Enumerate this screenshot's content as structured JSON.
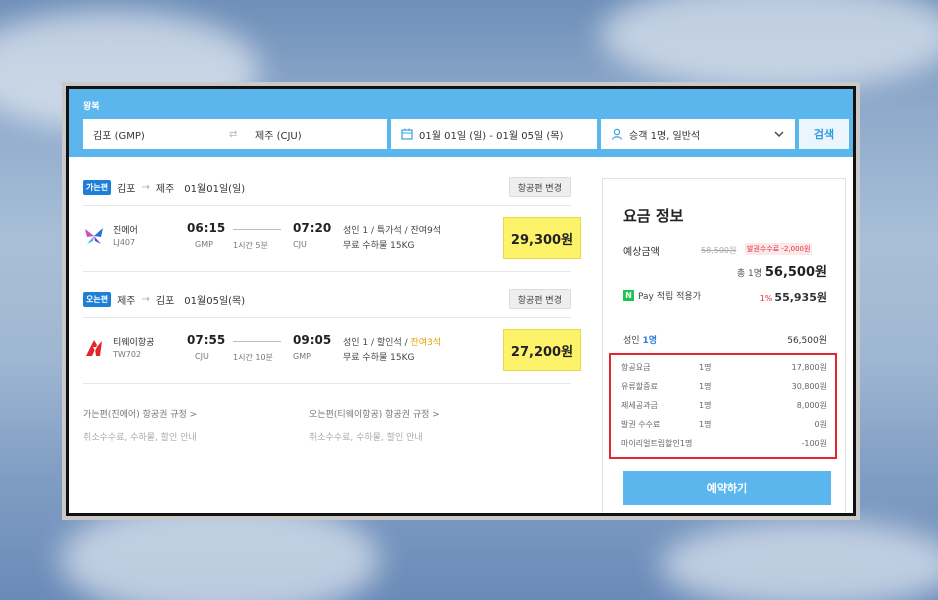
{
  "search": {
    "trip_type": "왕복",
    "from": "김포 (GMP)",
    "to": "제주 (CJU)",
    "swap": "⇄",
    "dates": "01월 01일 (일) - 01월 05일 (목)",
    "passengers": "승객 1명, 일반석",
    "search_button": "검색"
  },
  "outbound": {
    "badge": "가는편",
    "from": "김포",
    "arrow": "→",
    "to": "제주",
    "date": "01월01일(일)",
    "change_label": "항공편 변경",
    "airline": "진에어",
    "flight_no": "LJ407",
    "dep_time": "06:15",
    "arr_time": "07:20",
    "dep_code": "GMP",
    "arr_code": "CJU",
    "duration": "1시간 5분",
    "seat_info": "성인 1 / 특가석 / 잔여9석",
    "baggage": "무료 수하물 15KG",
    "price": "29,300원"
  },
  "inbound": {
    "badge": "오는편",
    "from": "제주",
    "arrow": "→",
    "to": "김포",
    "date": "01월05일(목)",
    "change_label": "항공편 변경",
    "airline": "티웨이항공",
    "flight_no": "TW702",
    "dep_time": "07:55",
    "arr_time": "09:05",
    "dep_code": "CJU",
    "arr_code": "GMP",
    "duration": "1시간 10분",
    "seat_info_prefix": "성인 1 / 할인석 / ",
    "seat_remaining": "잔여3석",
    "baggage": "무료 수하물 15KG",
    "price": "27,200원"
  },
  "rules": {
    "outbound_link": "가는편(진에어) 항공권 규정 >",
    "outbound_sub": "취소수수료, 수하물, 할인 안내",
    "inbound_link": "오는편(티웨이항공) 항공권 규정 >",
    "inbound_sub": "취소수수료, 수하물, 할인 안내"
  },
  "fare": {
    "title": "요금 정보",
    "estimate_label": "예상금액",
    "original_price": "58,500원",
    "issue_fee_note": "발권수수료 -2,000원",
    "total_prefix": "총 1명",
    "total": "56,500원",
    "npay_label": "Pay 적립 적용가",
    "npay_pct": "1%",
    "npay_value": "55,935원",
    "adult_prefix": "성인",
    "adult_count": "1명",
    "adult_value": "56,500원",
    "breakdown": [
      {
        "label": "항공요금",
        "count": "1명",
        "value": "17,800원"
      },
      {
        "label": "유류할증료",
        "count": "1명",
        "value": "30,800원"
      },
      {
        "label": "제세공과금",
        "count": "1명",
        "value": "8,000원"
      },
      {
        "label": "발권 수수료",
        "count": "1명",
        "value": "0원"
      },
      {
        "label": "마이리얼트립할인1명",
        "count": "",
        "value": "-100원"
      }
    ],
    "book_button": "예약하기"
  },
  "colors": {
    "brand_blue": "#5bb6ee",
    "price_highlight": "#fdf36b",
    "alert_red": "#e3262f"
  }
}
